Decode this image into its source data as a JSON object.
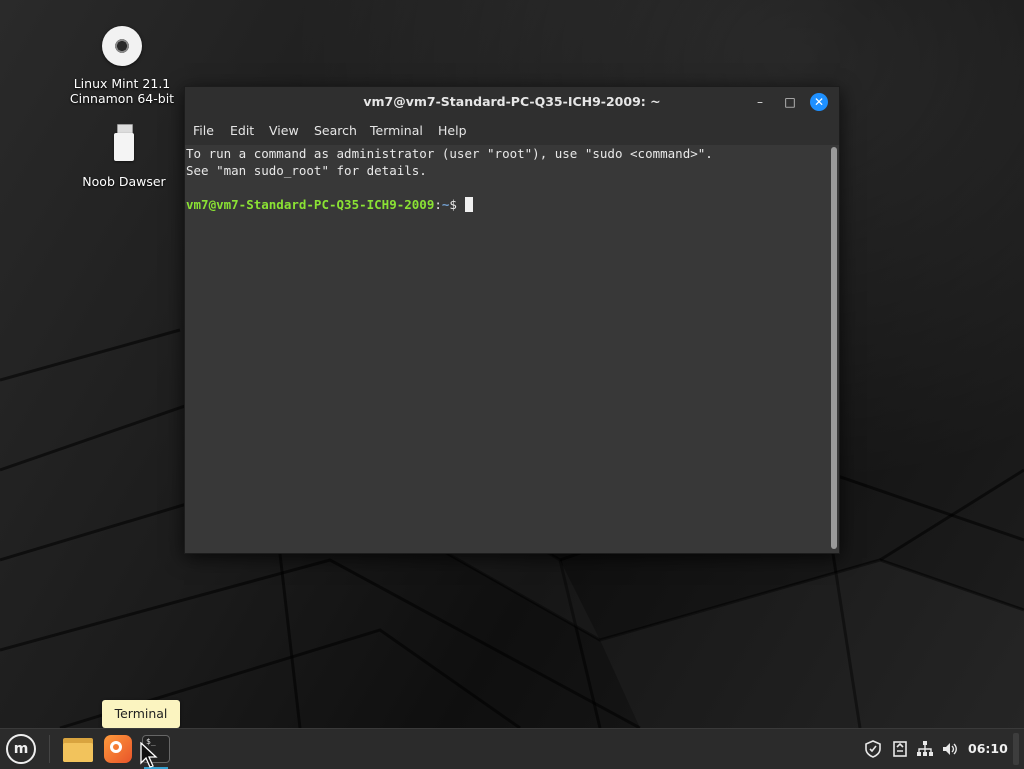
{
  "desktop": {
    "icons": [
      {
        "label_line1": "Linux Mint 21.1",
        "label_line2": "Cinnamon 64-bit",
        "icon": "disc-icon"
      },
      {
        "label_line1": "Noob Dawser",
        "label_line2": "",
        "icon": "usb-drive-icon"
      }
    ]
  },
  "terminal": {
    "title": "vm7@vm7-Standard-PC-Q35-ICH9-2009: ~",
    "window_buttons": {
      "minimize": "–",
      "maximize": "□",
      "close": "✕"
    },
    "menu": [
      "File",
      "Edit",
      "View",
      "Search",
      "Terminal",
      "Help"
    ],
    "lines": [
      "To run a command as administrator (user \"root\"), use \"sudo <command>\".",
      "See \"man sudo_root\" for details."
    ],
    "prompt": {
      "user_host": "vm7@vm7-Standard-PC-Q35-ICH9-2009",
      "separator": ":",
      "path": "~",
      "symbol": "$"
    }
  },
  "tooltip": {
    "text": "Terminal"
  },
  "taskbar": {
    "menu_logo": "m",
    "launchers": [
      {
        "name": "files",
        "icon": "folder-icon"
      },
      {
        "name": "firefox",
        "icon": "firefox-icon"
      },
      {
        "name": "terminal",
        "icon": "terminal-icon",
        "glyph": "$_"
      }
    ],
    "tray": {
      "icons": [
        "shield-icon",
        "clipboard-icon",
        "network-icon",
        "volume-icon"
      ],
      "clock": "06:10"
    }
  },
  "colors": {
    "prompt_user": "#8ae234",
    "prompt_path": "#729fcf",
    "close_button": "#1e90ff",
    "tooltip_bg": "#fbf4c0"
  }
}
